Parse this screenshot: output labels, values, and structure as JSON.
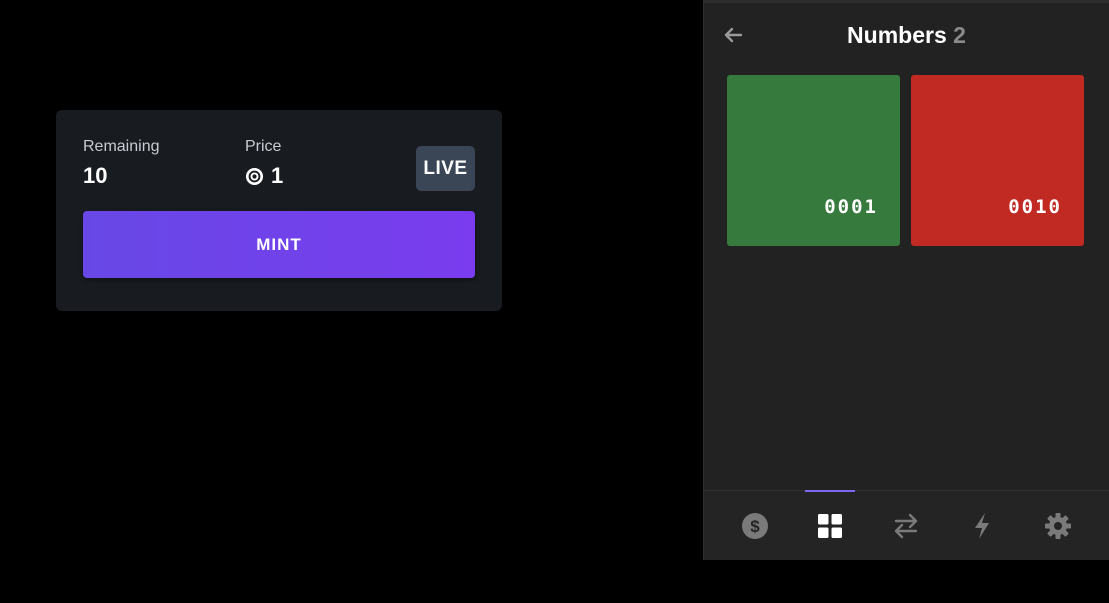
{
  "mint_card": {
    "remaining_label": "Remaining",
    "remaining_value": "10",
    "price_label": "Price",
    "price_value": "1",
    "price_icon": "solana-coin-icon",
    "status_badge": "LIVE",
    "mint_button_label": "MINT"
  },
  "wallet": {
    "title": "Numbers",
    "count": "2",
    "nfts": [
      {
        "label": "0001",
        "color": "#367b3d"
      },
      {
        "label": "0010",
        "color": "#c12923"
      }
    ],
    "nav": [
      {
        "icon": "dollar-icon",
        "active": false
      },
      {
        "icon": "grid-icon",
        "active": true
      },
      {
        "icon": "swap-icon",
        "active": false
      },
      {
        "icon": "lightning-icon",
        "active": false
      },
      {
        "icon": "gear-icon",
        "active": false
      }
    ]
  },
  "colors": {
    "accent": "#7b68ee",
    "mint_gradient_start": "#6748e6",
    "mint_gradient_end": "#7a3cee",
    "card_background": "#181c21",
    "panel_background": "#222222"
  }
}
